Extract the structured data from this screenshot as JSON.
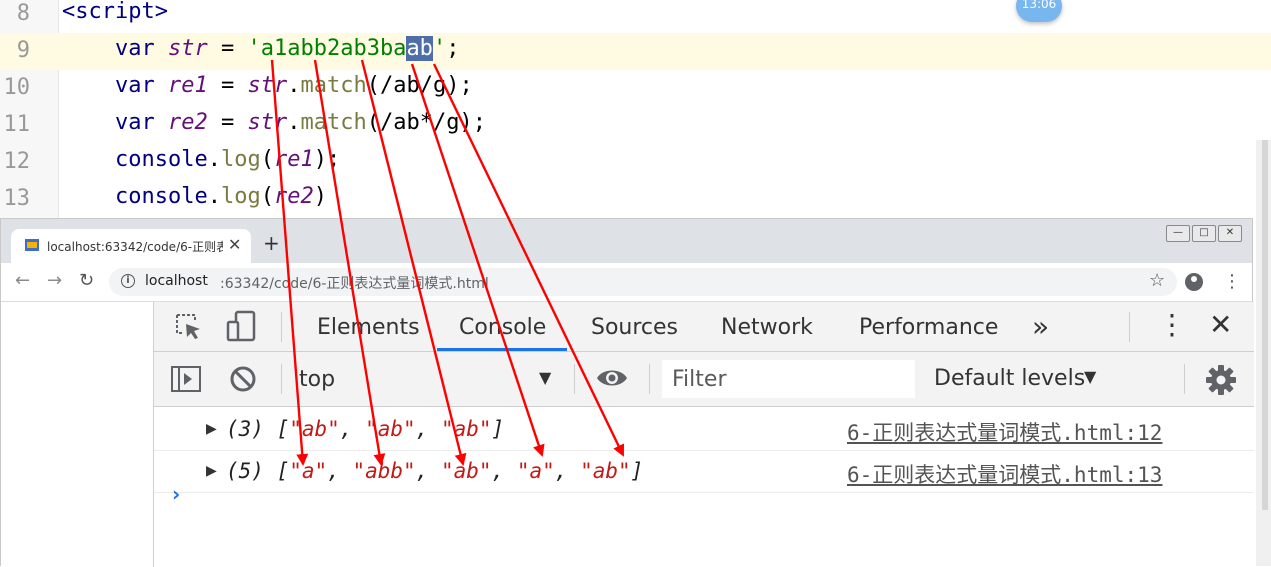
{
  "editor": {
    "line_numbers": [
      "8",
      "9",
      "10",
      "11",
      "12",
      "13"
    ],
    "lines": {
      "l8": {
        "script_tag": "<script>"
      },
      "l9": {
        "kw": "var",
        "var": "str",
        "eq": " = ",
        "str_open": "'",
        "str_plain": "a1abb2ab3ba",
        "str_selected": "ab",
        "str_close": "'",
        "end": ";"
      },
      "l10": {
        "kw": "var",
        "var": "re1",
        "eq": " = ",
        "obj": "str",
        "dot": ".",
        "method": "match",
        "arg": "(/ab/g)",
        "end": ";"
      },
      "l11": {
        "kw": "var",
        "var": "re2",
        "eq": " = ",
        "obj": "str",
        "dot": ".",
        "method": "match",
        "arg": "(/ab*/g)",
        "end": ";"
      },
      "l12": {
        "console": "console",
        "dot": ".",
        "method": "log",
        "open": "(",
        "var": "re1",
        "close": ");"
      },
      "l13": {
        "console": "console",
        "dot": ".",
        "method": "log",
        "open": "(",
        "var": "re2",
        "close": ")"
      }
    },
    "time_badge": "13:06"
  },
  "browser": {
    "tab_title": "localhost:63342/code/6-正则表",
    "tab_close": "✕",
    "new_tab": "+",
    "window_buttons": [
      "—",
      "□",
      "✕"
    ],
    "url_host": "localhost",
    "url_rest": ":63342/code/6-正则表达式量词模式.html"
  },
  "devtools": {
    "tabs": [
      "Elements",
      "Console",
      "Sources",
      "Network",
      "Performance"
    ],
    "more_tabs": "»",
    "context": "top",
    "filter_placeholder": "Filter",
    "levels": "Default levels",
    "messages": [
      {
        "count": "(3) [",
        "items": [
          "\"ab\"",
          "\"ab\"",
          "\"ab\""
        ],
        "close": "]",
        "source": "6-正则表达式量词模式.html:12"
      },
      {
        "count": "(5) [",
        "items": [
          "\"a\"",
          "\"abb\"",
          "\"ab\"",
          "\"a\"",
          "\"ab\""
        ],
        "close": "]",
        "source": "6-正则表达式量词模式.html:13"
      }
    ],
    "prompt": "›"
  },
  "colors": {
    "arrow": "#ff0000",
    "accent": "#1a73e8",
    "string": "#c41a16"
  }
}
